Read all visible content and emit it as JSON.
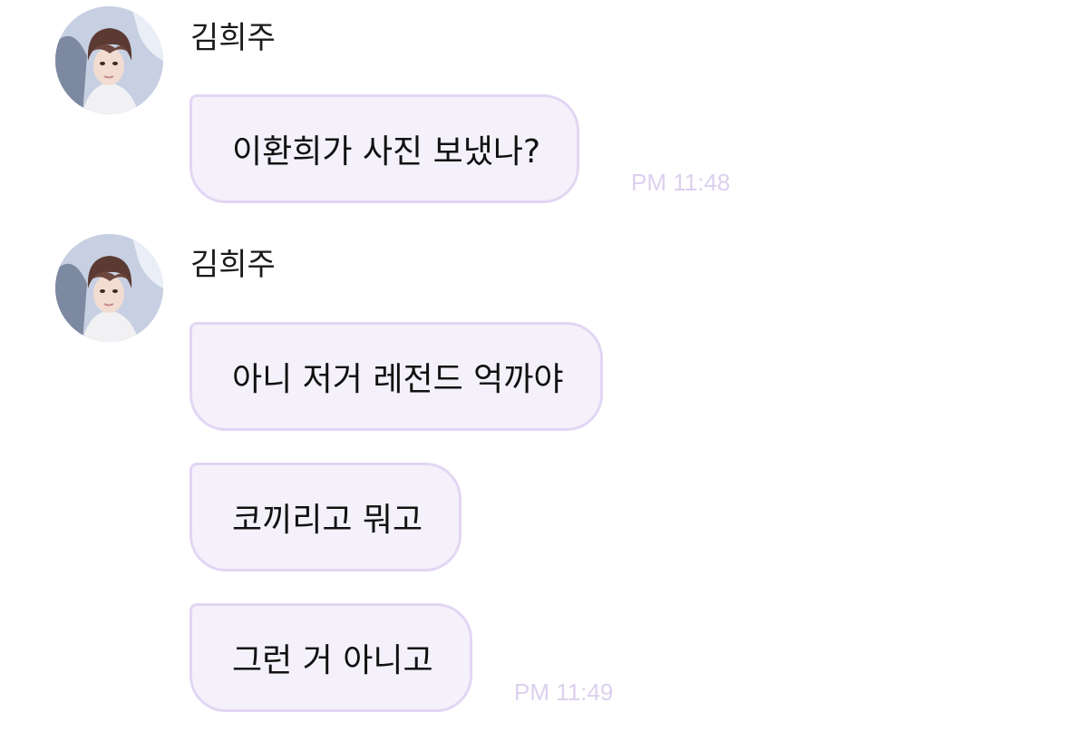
{
  "messages": [
    {
      "sender": "김희주",
      "bubbles": [
        "이환희가 사진 보냈나?"
      ],
      "time": "PM 11:48"
    },
    {
      "sender": "김희주",
      "bubbles": [
        "아니 저거 레전드 억까야",
        "코끼리고 뭐고",
        "그런 거 아니고"
      ],
      "time": "PM 11:49"
    }
  ],
  "colors": {
    "bubble_bg": "#f4f1fa",
    "bubble_border": "#e2d6f3",
    "time_text": "#dcd0ee"
  },
  "icons": {
    "avatar": "profile-photo"
  }
}
